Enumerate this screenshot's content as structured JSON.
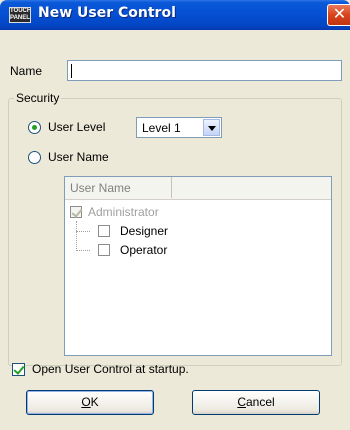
{
  "window": {
    "title": "New User Control",
    "icon_text": "TOUCH\nPANEL",
    "close_symbol": "✕"
  },
  "name_field": {
    "label": "Name",
    "value": ""
  },
  "security": {
    "group_label": "Security",
    "user_level": {
      "label": "User Level",
      "selected": true,
      "combo_value": "Level 1"
    },
    "user_name": {
      "label": "User Name",
      "selected": false
    },
    "list": {
      "column_header": "User Name",
      "items": [
        {
          "label": "Administrator",
          "checked": true,
          "disabled": true
        },
        {
          "label": "Designer",
          "checked": false,
          "disabled": false
        },
        {
          "label": "Operator",
          "checked": false,
          "disabled": false
        }
      ]
    }
  },
  "startup": {
    "label": "Open User Control at startup.",
    "checked": true
  },
  "buttons": {
    "ok": {
      "mnemonic": "O",
      "rest": "K"
    },
    "cancel": {
      "mnemonic": "C",
      "rest": "ancel"
    }
  },
  "colors": {
    "titlebar": "#0550d4",
    "dialog_bg": "#ece9d8",
    "radio_dot": "#21a121",
    "disabled_text": "#a0a0a0"
  },
  "icons": [
    "app-icon",
    "close-icon",
    "dropdown-arrow-icon",
    "check-icon"
  ]
}
